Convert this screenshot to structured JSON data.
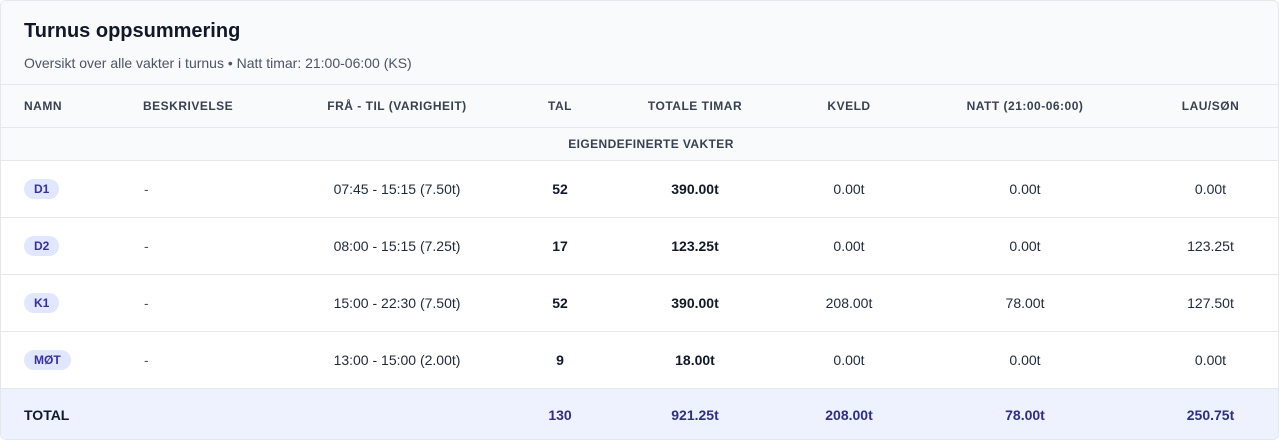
{
  "header": {
    "title": "Turnus oppsummering",
    "subtitle": "Oversikt over alle vakter i turnus • Natt timar: 21:00-06:00 (KS)"
  },
  "columns": {
    "name": "NAMN",
    "desc": "BESKRIVELSE",
    "time": "FRÅ - TIL (VARIGHEIT)",
    "tal": "TAL",
    "total": "TOTALE TIMAR",
    "kveld": "KVELD",
    "natt": "NATT (21:00-06:00)",
    "lau": "LAU/SØN"
  },
  "group": {
    "label": "EIGENDEFINERTE VAKTER"
  },
  "rows": [
    {
      "name": "D1",
      "desc": "-",
      "time": "07:45 - 15:15 (7.50t)",
      "tal": "52",
      "total": "390.00t",
      "kveld": "0.00t",
      "natt": "0.00t",
      "lau": "0.00t"
    },
    {
      "name": "D2",
      "desc": "-",
      "time": "08:00 - 15:15 (7.25t)",
      "tal": "17",
      "total": "123.25t",
      "kveld": "0.00t",
      "natt": "0.00t",
      "lau": "123.25t"
    },
    {
      "name": "K1",
      "desc": "-",
      "time": "15:00 - 22:30 (7.50t)",
      "tal": "52",
      "total": "390.00t",
      "kveld": "208.00t",
      "natt": "78.00t",
      "lau": "127.50t"
    },
    {
      "name": "MØT",
      "desc": "-",
      "time": "13:00 - 15:00 (2.00t)",
      "tal": "9",
      "total": "18.00t",
      "kveld": "0.00t",
      "natt": "0.00t",
      "lau": "0.00t"
    }
  ],
  "totals": {
    "label": "TOTAL",
    "tal": "130",
    "total": "921.25t",
    "kveld": "208.00t",
    "natt": "78.00t",
    "lau": "250.75t"
  },
  "colors": {
    "badge_bg": "#e0e7ff",
    "badge_text": "#3730a3",
    "total_bg": "#eef2ff",
    "total_text": "#312e81"
  }
}
